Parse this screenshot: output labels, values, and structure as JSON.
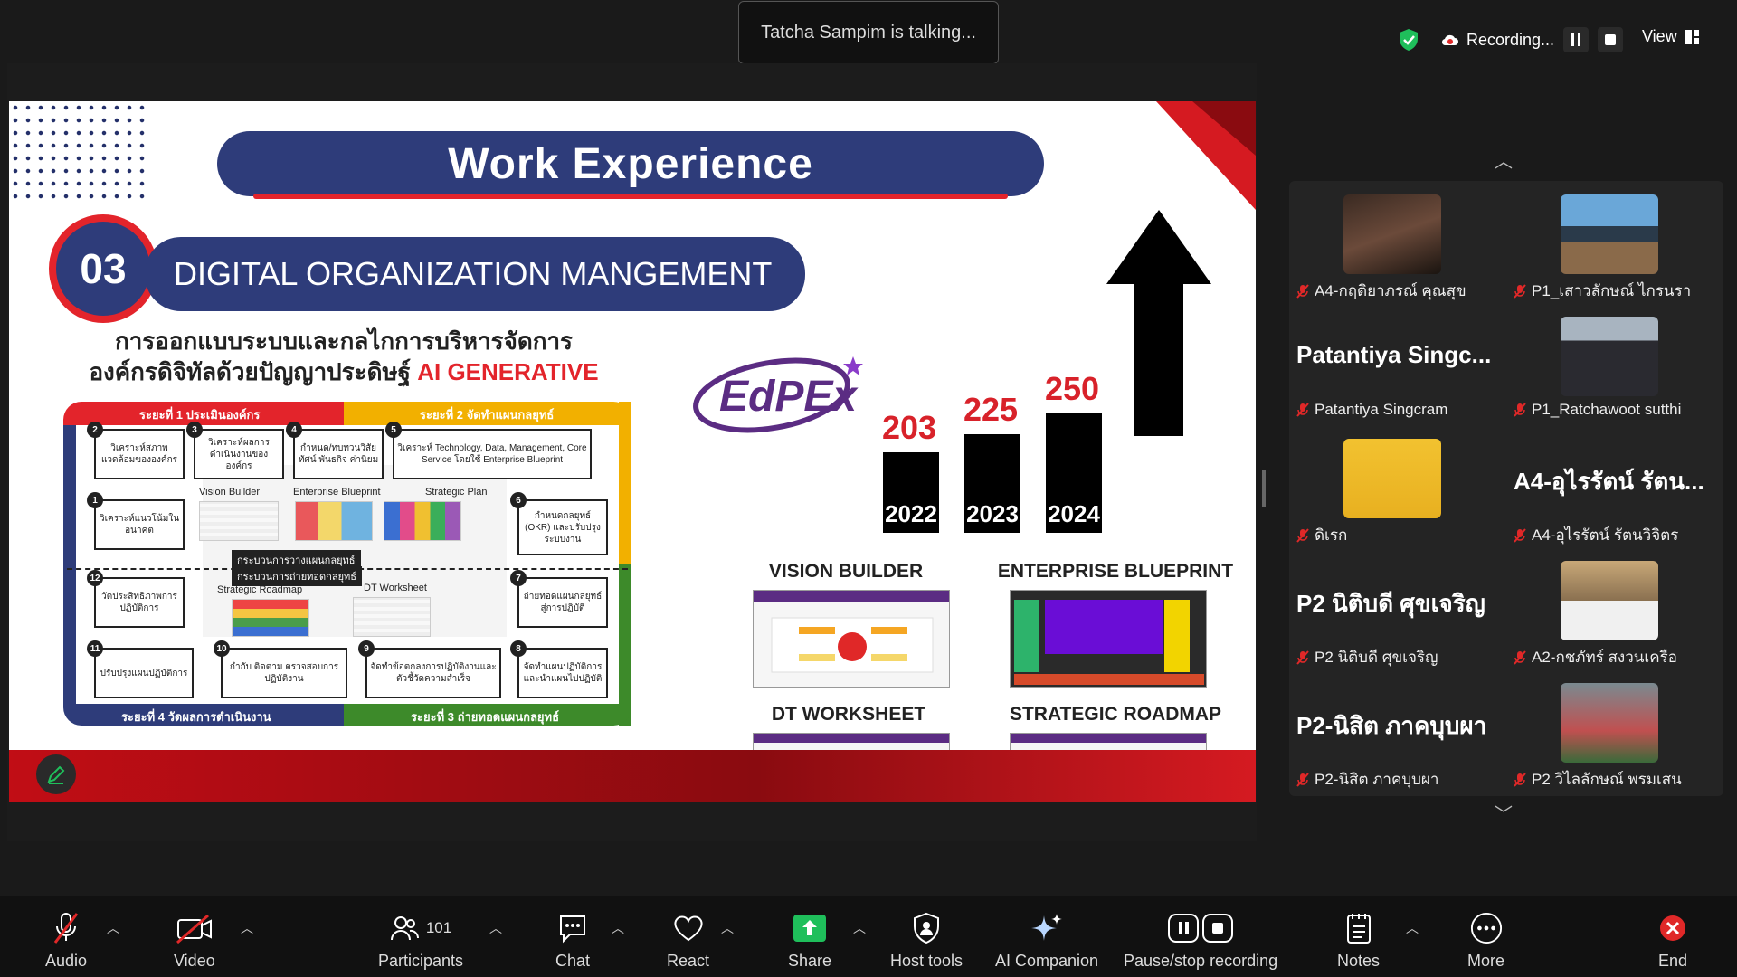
{
  "talking": "Tatcha Sampim is talking...",
  "recording": {
    "label": "Recording..."
  },
  "view": {
    "label": "View"
  },
  "slide": {
    "title": "Work  Experience",
    "section_number": "03",
    "section_title": "DIGITAL ORGANIZATION MANGEMENT",
    "thai_line1": "การออกแบบระบบและกลไกการบริหารจัดการ",
    "thai_line2": "องค์กรดิจิทัลด้วยปัญญาประดิษฐ์",
    "thai_ai": "AI GENERATIVE",
    "phases": {
      "p1": "ระยะที่ 1 ประเมินองค์กร",
      "p2": "ระยะที่ 2 จัดทำแผนกลยุทธ์",
      "p3": "ระยะที่ 3 ถ่ายทอดแผนกลยุทธ์",
      "p4": "ระยะที่ 4 วัดผลการดำเนินงาน"
    },
    "steps": [
      {
        "n": "1",
        "text": "วิเคราะห์แนวโน้มในอนาคต"
      },
      {
        "n": "2",
        "text": "วิเคราะห์สภาพแวดล้อมขององค์กร"
      },
      {
        "n": "3",
        "text": "วิเคราะห์ผลการดำเนินงานขององค์กร"
      },
      {
        "n": "4",
        "text": "กำหนด/ทบทวนวิสัยทัศน์ พันธกิจ ค่านิยม"
      },
      {
        "n": "5",
        "text": "วิเคราะห์ Technology, Data, Management, Core Service โดยใช้ Enterprise Blueprint"
      },
      {
        "n": "6",
        "text": "กำหนดกลยุทธ์ (OKR) และปรับปรุงระบบงาน"
      },
      {
        "n": "7",
        "text": "ถ่ายทอดแผนกลยุทธ์สู่การปฏิบัติ"
      },
      {
        "n": "8",
        "text": "จัดทำแผนปฏิบัติการและนำแผนไปปฏิบัติ"
      },
      {
        "n": "9",
        "text": "จัดทำข้อตกลงการปฏิบัติงานและตัวชี้วัดความสำเร็จ"
      },
      {
        "n": "10",
        "text": "กำกับ ติดตาม ตรวจสอบการปฏิบัติงาน"
      },
      {
        "n": "11",
        "text": "ปรับปรุงแผนปฏิบัติการ"
      },
      {
        "n": "12",
        "text": "วัดประสิทธิภาพการปฏิบัติการ"
      }
    ],
    "mini": {
      "vision": "Vision Builder",
      "blueprint": "Enterprise Blueprint",
      "strategic": "Strategic Plan",
      "roadmap": "Strategic Roadmap",
      "worksheet": "DT Worksheet",
      "tag1": "กระบวนการวางแผนกลยุทธ์",
      "tag2": "กระบวนการถ่ายทอดกลยุทธ์"
    },
    "logo": "EdPEx",
    "screens": {
      "vision": "VISION BUILDER",
      "blueprint": "ENTERPRISE BLUEPRINT",
      "worksheet": "DT WORKSHEET",
      "roadmap": "STRATEGIC ROADMAP"
    }
  },
  "chart_data": {
    "type": "bar",
    "categories": [
      "2022",
      "2023",
      "2024"
    ],
    "values": [
      203,
      225,
      250
    ],
    "title": "",
    "xlabel": "",
    "ylabel": ""
  },
  "participants_tiles": [
    {
      "display": "A4-กฤติยาภรณ์ คุณสุข",
      "has_photo": true
    },
    {
      "display": "P1_เสาวลักษณ์ ไกรนรา",
      "has_photo": true
    },
    {
      "big": "Patantiya  Singc...",
      "display": "Patantiya Singcram",
      "has_photo": false
    },
    {
      "display": "P1_Ratchawoot sutthi",
      "has_photo": true
    },
    {
      "display": "ดิเรก",
      "has_photo": true
    },
    {
      "big": "A4-อุไรรัตน์ รัตน...",
      "display": "A4-อุไรรัตน์ รัตนวิจิตร",
      "has_photo": false
    },
    {
      "big": "P2 นิติบดี ศุขเจริญ",
      "display": "P2 นิติบดี ศุขเจริญ",
      "has_photo": false
    },
    {
      "display": "A2-กชภัทร์ สงวนเครือ",
      "has_photo": true
    },
    {
      "big": "P2-นิสิต ภาคบุบผา",
      "display": "P2-นิสิต ภาคบุบผา",
      "has_photo": false
    },
    {
      "display": "P2 วิไลลักษณ์ พรมเสน",
      "has_photo": true
    }
  ],
  "toolbar": {
    "audio": "Audio",
    "video": "Video",
    "participants": "Participants",
    "participants_count": "101",
    "chat": "Chat",
    "react": "React",
    "share": "Share",
    "host_tools": "Host tools",
    "ai_companion": "AI Companion",
    "pause_recording": "Pause/stop recording",
    "notes": "Notes",
    "more": "More",
    "end": "End"
  },
  "colors": {
    "brand_navy": "#2e3c7a",
    "accent_red": "#e3242b",
    "share_green": "#1fbf5b",
    "end_red": "#e02828"
  }
}
